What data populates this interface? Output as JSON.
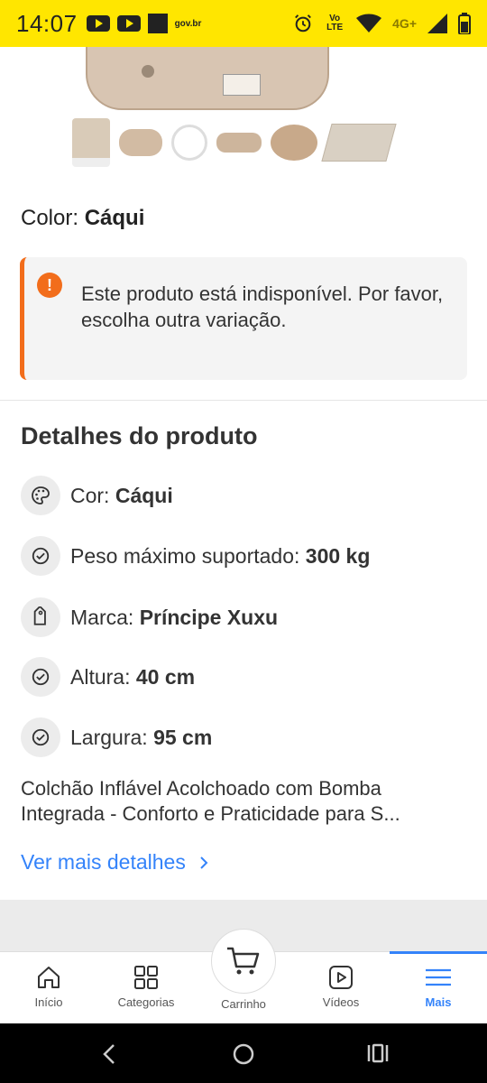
{
  "status_bar": {
    "time": "14:07",
    "brand": "gov.br",
    "volte": "Vo LTE",
    "network": "4G+"
  },
  "product": {
    "color_label": "Color:",
    "color_value": "Cáqui"
  },
  "alert": {
    "message": "Este produto está indisponível. Por favor, escolha outra variação.",
    "icon": "exclamation-icon",
    "accent_color": "#f26d1b"
  },
  "details": {
    "title": "Detalhes do produto",
    "items": [
      {
        "label": "Cor:",
        "value": "Cáqui",
        "icon": "palette-icon"
      },
      {
        "label": "Peso máximo suportado:",
        "value": "300 kg",
        "icon": "check-circle-icon"
      },
      {
        "label": "Marca:",
        "value": "Príncipe Xuxu",
        "icon": "tag-icon"
      },
      {
        "label": "Altura:",
        "value": "40 cm",
        "icon": "check-circle-icon"
      },
      {
        "label": "Largura:",
        "value": "95 cm",
        "icon": "check-circle-icon"
      }
    ],
    "description_line1": "Colchão Inflável Acolchoado com Bomba",
    "description_line2": "Integrada - Conforto e Praticidade para S...",
    "more_link": "Ver mais detalhes"
  },
  "bottom_nav": {
    "items": [
      {
        "label": "Início",
        "icon": "home-icon"
      },
      {
        "label": "Categorias",
        "icon": "grid-icon"
      },
      {
        "label": "Carrinho",
        "icon": "cart-icon"
      },
      {
        "label": "Vídeos",
        "icon": "video-icon"
      },
      {
        "label": "Mais",
        "icon": "menu-icon"
      }
    ],
    "active_color": "#3483fa"
  }
}
